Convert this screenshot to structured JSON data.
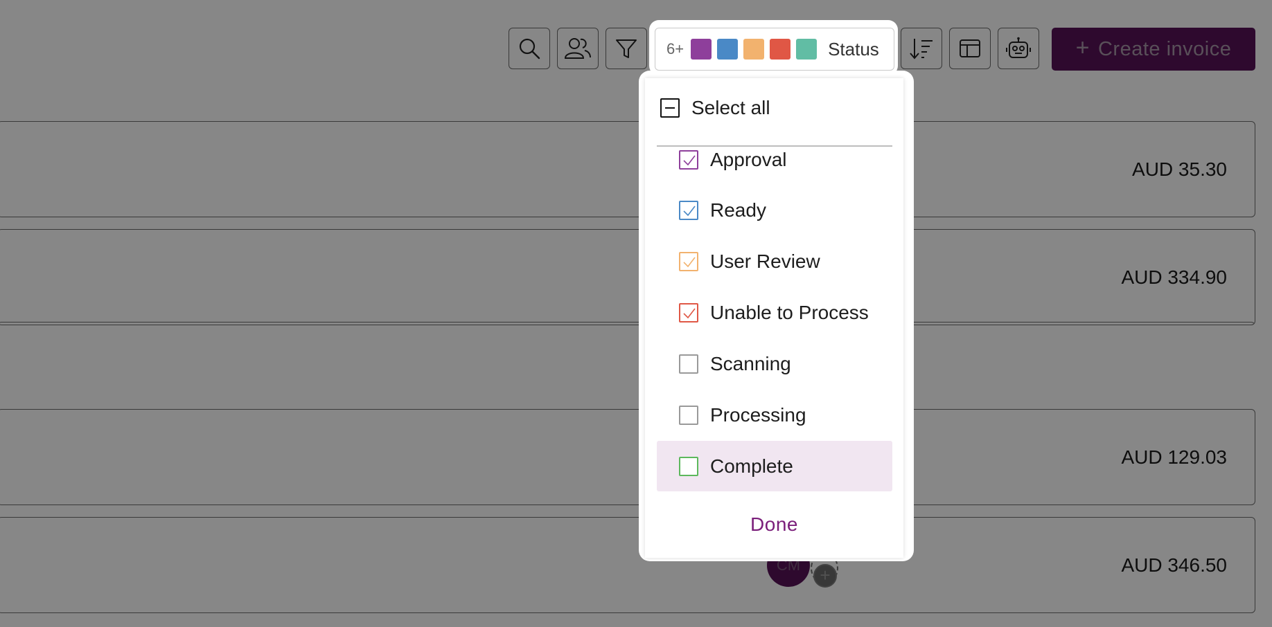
{
  "toolbar": {
    "search_icon": "search-icon",
    "users_icon": "users-icon",
    "filter_icon": "filter-icon",
    "sort_icon": "sort-icon",
    "layout_icon": "layout-icon",
    "bot_icon": "bot-icon",
    "create_label": "Create invoice"
  },
  "status_filter": {
    "count": "6+",
    "label": "Status",
    "swatches": [
      "#8e3f9b",
      "#4a89c6",
      "#f2b26e",
      "#e05745",
      "#61bda4"
    ]
  },
  "dropdown": {
    "select_all_label": "Select all",
    "options": [
      {
        "label": "Approval",
        "checked": true,
        "color": "#8e3f9b"
      },
      {
        "label": "Ready",
        "checked": true,
        "color": "#4a89c6"
      },
      {
        "label": "User Review",
        "checked": true,
        "color": "#f2b26e"
      },
      {
        "label": "Unable to Process",
        "checked": true,
        "color": "#e05745"
      },
      {
        "label": "Scanning",
        "checked": false,
        "color": "#999999"
      },
      {
        "label": "Processing",
        "checked": false,
        "color": "#999999"
      },
      {
        "label": "Complete",
        "checked": false,
        "color": "#5cb85c"
      }
    ],
    "done_label": "Done"
  },
  "rows": [
    {
      "amount": "AUD 35.30"
    },
    {
      "amount": "AUD 334.90"
    },
    {
      "amount": ""
    },
    {
      "amount": "AUD 129.03"
    },
    {
      "amount": "AUD 346.50"
    }
  ],
  "avatar": {
    "initials": "CM"
  },
  "colors": {
    "brand": "#7a1e7a",
    "hover": "#f1e6f1"
  }
}
